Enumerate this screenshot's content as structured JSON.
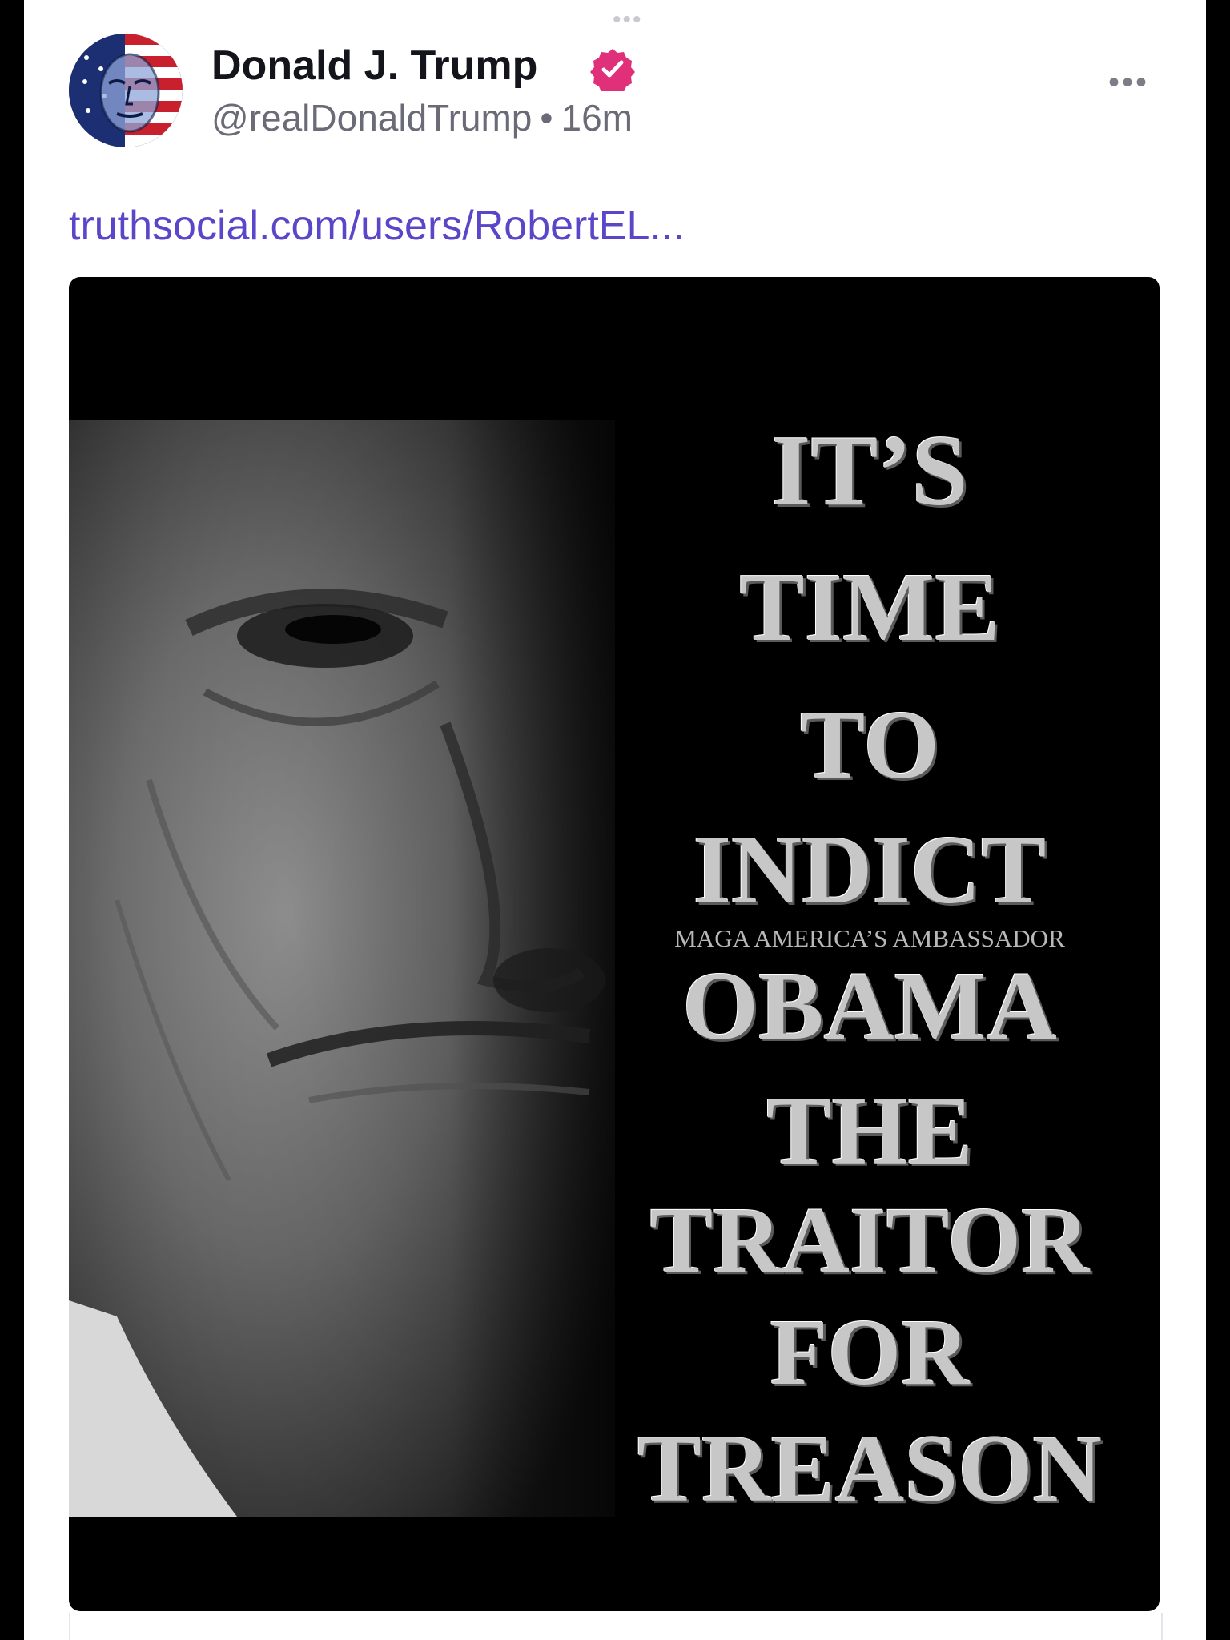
{
  "post": {
    "author_name": "Donald J. Trump",
    "handle": "@realDonaldTrump",
    "separator": "•",
    "time_ago": "16m",
    "link_text": "truthsocial.com/users/RobertEL...",
    "more_label": "•••",
    "top_handle": "•••"
  },
  "poster": {
    "lines": [
      "IT’S",
      "TIME",
      "TO",
      "INDICT",
      "OBAMA",
      "THE",
      "TRAITOR",
      "FOR",
      "TREASON"
    ],
    "subtitle": "MAGA AMERICA’S AMBASSADOR"
  },
  "colors": {
    "link": "#5a46c8",
    "verified_badge": "#e0307a",
    "name": "#14141c",
    "muted": "#6b6b78"
  },
  "icons": {
    "verified": "verified-badge-icon",
    "more": "more-options-icon"
  }
}
